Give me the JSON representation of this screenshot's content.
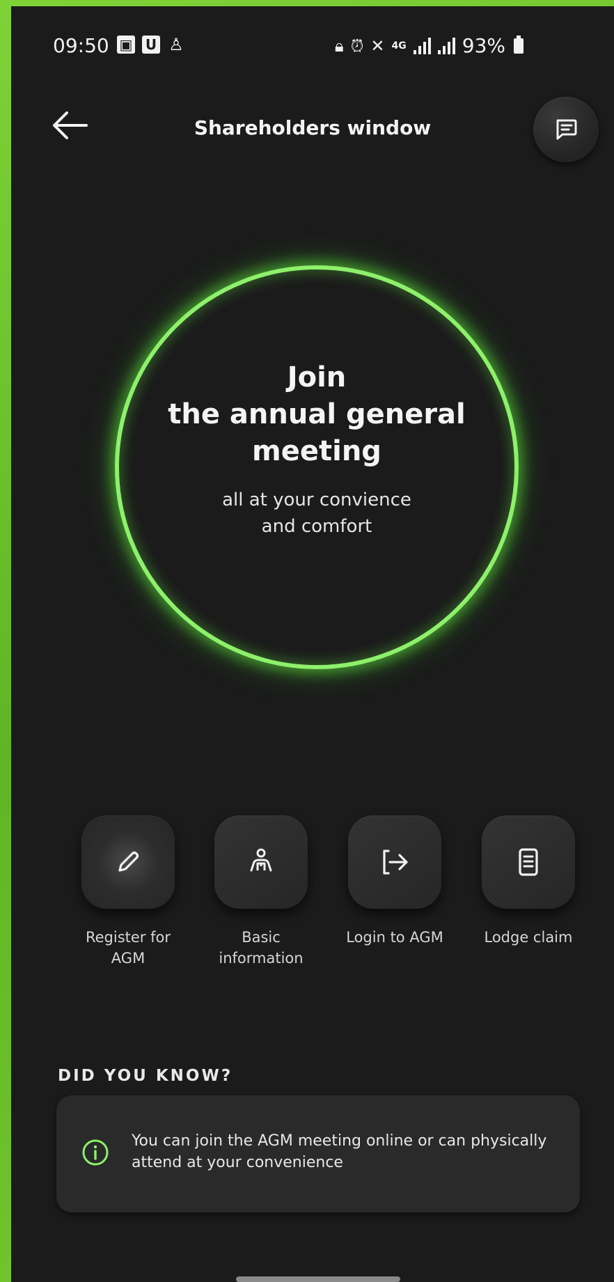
{
  "status_bar": {
    "time": "09:50",
    "network": "4G",
    "battery": "93%"
  },
  "header": {
    "title": "Shareholders window"
  },
  "hero": {
    "title_line1": "Join",
    "title_line2": "the annual general",
    "title_line3": "meeting",
    "subtitle_line1": "all at your convience",
    "subtitle_line2": "and comfort"
  },
  "actions": [
    {
      "label_line1": "Register for",
      "label_line2": "AGM",
      "icon": "pencil-icon"
    },
    {
      "label_line1": "Basic",
      "label_line2": "information",
      "icon": "person-icon"
    },
    {
      "label_line1": "Login to AGM",
      "label_line2": "",
      "icon": "login-icon"
    },
    {
      "label_line1": "Lodge claim",
      "label_line2": "",
      "icon": "document-icon"
    }
  ],
  "did_you_know": {
    "heading": "DID YOU KNOW?",
    "text": "You can join the AGM meeting online or can physically attend at your convenience"
  },
  "colors": {
    "background": "#1b1b1b",
    "accent_green": "#8ef06b",
    "frame_green": "#6fc42a"
  }
}
